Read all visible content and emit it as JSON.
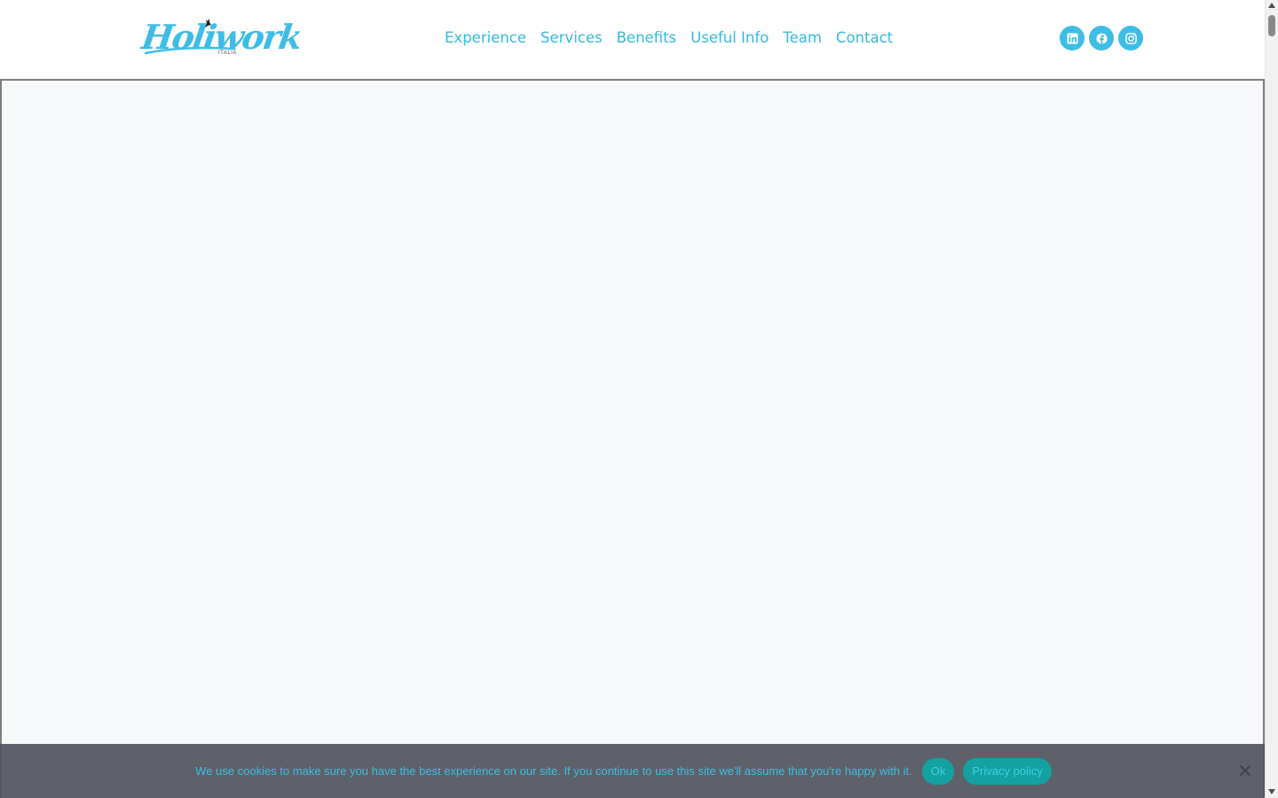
{
  "header": {
    "logo": {
      "text": "Holiwork",
      "subtext": "ITALIA",
      "brand_color": "#3dbde6"
    },
    "nav": {
      "items": [
        {
          "label": "Experience"
        },
        {
          "label": "Services"
        },
        {
          "label": "Benefits"
        },
        {
          "label": "Useful Info"
        },
        {
          "label": "Team"
        },
        {
          "label": "Contact"
        }
      ],
      "color": "#35b9e0"
    },
    "social": [
      {
        "icon": "linkedin-icon"
      },
      {
        "icon": "facebook-icon"
      },
      {
        "icon": "instagram-icon"
      }
    ]
  },
  "content": {
    "background": "#f6f8fa"
  },
  "cookie_bar": {
    "message": "We use cookies to make sure you have the best experience on our site. If you continue to use this site we'll assume that you're happy with it.",
    "ok_label": "Ok",
    "privacy_label": "Privacy policy",
    "close_icon": "close-icon",
    "button_color": "#13a1a1"
  }
}
